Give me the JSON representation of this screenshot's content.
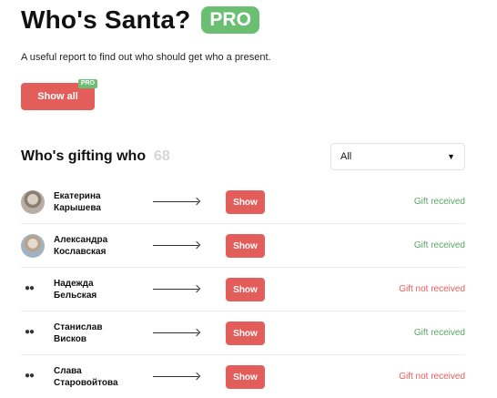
{
  "header": {
    "title": "Who's Santa?",
    "pro_label": "PRO",
    "description": "A useful report to find out who should get who a present."
  },
  "show_all": {
    "label": "Show all",
    "badge": "PRO"
  },
  "section": {
    "title": "Who's gifting who",
    "count": "68"
  },
  "filter": {
    "value": "All",
    "caret": "▼"
  },
  "colors": {
    "accent_red": "#e35d5b",
    "success_green": "#5aa665",
    "pro_green": "#6bbf73"
  },
  "rows": [
    {
      "name_first": "Екатерина",
      "name_last": "Карышева",
      "avatar": "photo",
      "button": "Show",
      "status": "Gift received",
      "status_type": "ok"
    },
    {
      "name_first": "Александра",
      "name_last": "Кослaвская",
      "avatar": "photo",
      "button": "Show",
      "status": "Gift received",
      "status_type": "ok"
    },
    {
      "name_first": "Надежда",
      "name_last": "Бельская",
      "avatar": "eyes",
      "button": "Show",
      "status": "Gift not received",
      "status_type": "bad"
    },
    {
      "name_first": "Станислав",
      "name_last": "Висков",
      "avatar": "eyes",
      "button": "Show",
      "status": "Gift received",
      "status_type": "ok"
    },
    {
      "name_first": "Слава",
      "name_last": "Старовойтова",
      "avatar": "eyes",
      "button": "Show",
      "status": "Gift not received",
      "status_type": "bad"
    }
  ]
}
